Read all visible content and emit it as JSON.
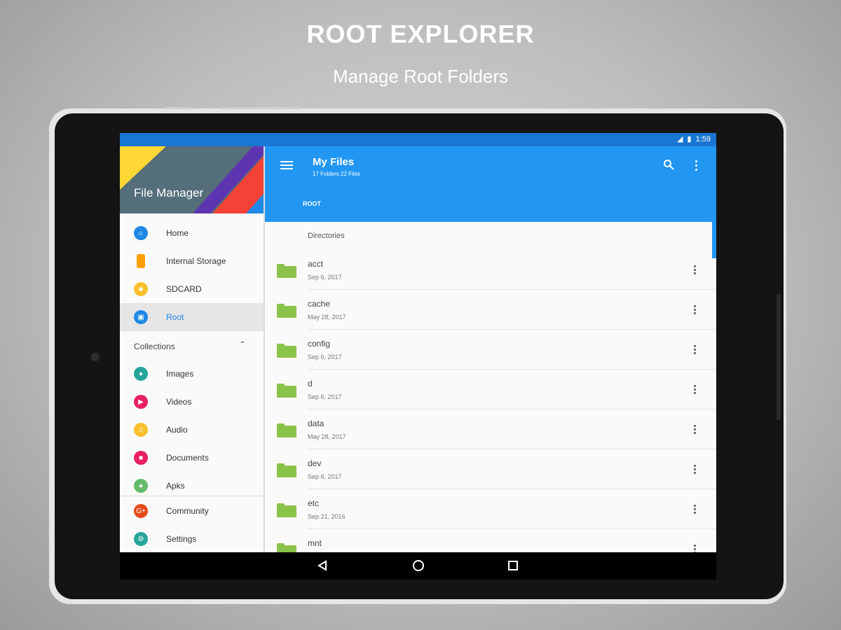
{
  "promo": {
    "title": "ROOT EXPLORER",
    "subtitle": "Manage Root Folders"
  },
  "status_bar": {
    "time": "1:59"
  },
  "drawer": {
    "header_title": "File Manager",
    "items": [
      {
        "label": "Home",
        "icon": "home-icon",
        "color": "#1e88e5"
      },
      {
        "label": "Internal Storage",
        "icon": "phone-icon",
        "color": "#ffa000"
      },
      {
        "label": "SDCARD",
        "icon": "sdcard-icon",
        "color": "#fbc02d"
      },
      {
        "label": "Root",
        "icon": "root-icon",
        "color": "#1e88e5",
        "active": true
      }
    ],
    "collections_label": "Collections",
    "collections": [
      {
        "label": "Images",
        "icon": "images-icon",
        "color": "#26a69a"
      },
      {
        "label": "Videos",
        "icon": "videos-icon",
        "color": "#e91e63"
      },
      {
        "label": "Audio",
        "icon": "audio-icon",
        "color": "#fbc02d"
      },
      {
        "label": "Documents",
        "icon": "documents-icon",
        "color": "#e91e63"
      },
      {
        "label": "Apks",
        "icon": "apks-icon",
        "color": "#66bb6a"
      }
    ],
    "footer": [
      {
        "label": "Community",
        "icon": "community-icon",
        "color": "#e64a19"
      },
      {
        "label": "Settings",
        "icon": "settings-icon",
        "color": "#26a69a"
      }
    ]
  },
  "appbar": {
    "title": "My Files",
    "subtitle": "17 Folders 22 Files",
    "breadcrumb": "ROOT"
  },
  "list": {
    "header": "Directories",
    "rows": [
      {
        "name": "acct",
        "date": "Sep 6, 2017"
      },
      {
        "name": "cache",
        "date": "May 28, 2017"
      },
      {
        "name": "config",
        "date": "Sep 6, 2017"
      },
      {
        "name": "d",
        "date": "Sep 6, 2017"
      },
      {
        "name": "data",
        "date": "May 28, 2017"
      },
      {
        "name": "dev",
        "date": "Sep 6, 2017"
      },
      {
        "name": "etc",
        "date": "Sep 21, 2016"
      },
      {
        "name": "mnt",
        "date": ""
      }
    ]
  },
  "colors": {
    "primary": "#2196f3",
    "status_bar": "#1976d2",
    "folder": "#8bc34a"
  }
}
